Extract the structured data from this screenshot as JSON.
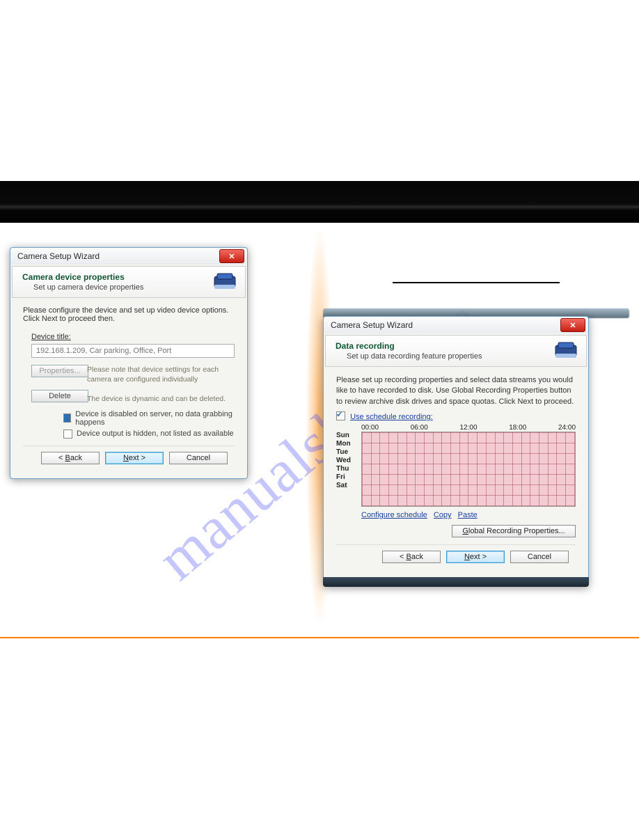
{
  "watermark": "manualshiv.com",
  "dialog_left": {
    "window_title": "Camera Setup Wizard",
    "header_title": "Camera device properties",
    "header_sub": "Set up camera device properties",
    "intro": "Please configure the device and set up video device options. Click Next to proceed then.",
    "device_label": "Device title:",
    "device_value": "192.168.1.209, Car parking, Office, Port",
    "properties_btn": "Properties...",
    "delete_btn": "Delete",
    "note_individually": "Please note that device settings for each camera are configured individually",
    "note_dynamic": "The device is dynamic and can be deleted.",
    "chk_disabled": "Device is disabled on server, no data grabbing happens",
    "chk_hidden": "Device output is hidden, not listed as available",
    "back": "< Back",
    "next": "Next >",
    "cancel": "Cancel"
  },
  "dialog_right": {
    "window_title": "Camera Setup Wizard",
    "header_title": "Data recording",
    "header_sub": "Set up data recording feature properties",
    "intro": "Please set up recording properties and select data streams you would like to have recorded to disk. Use Global Recording Properties button to review archive disk drives and space quotas. Click Next to proceed.",
    "chk_schedule": "Use schedule recording:",
    "times": [
      "00:00",
      "06:00",
      "12:00",
      "18:00",
      "24:00"
    ],
    "days": [
      "Sun",
      "Mon",
      "Tue",
      "Wed",
      "Thu",
      "Fri",
      "Sat"
    ],
    "link_configure": "Configure schedule",
    "link_copy": "Copy",
    "link_paste": "Paste",
    "global_btn": "Global Recording Properties...",
    "back": "< Back",
    "next": "Next >",
    "cancel": "Cancel"
  }
}
